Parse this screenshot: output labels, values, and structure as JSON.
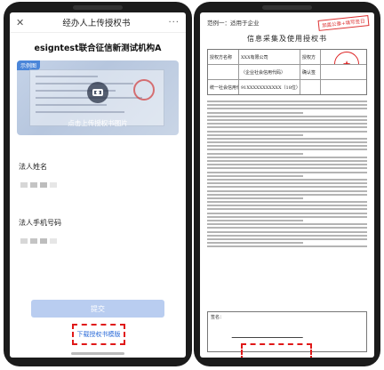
{
  "left_phone": {
    "nav": {
      "close_icon": "close-icon",
      "title": "经办人上传授权书",
      "more": "···"
    },
    "org_name": "esigntest联合征信新测试机构A",
    "upload": {
      "sample_tag": "示例图",
      "hint": "点击上传授权书图片"
    },
    "fields": [
      {
        "label": "法人姓名"
      },
      {
        "label": "法人手机号码"
      }
    ],
    "submit_label": "提交",
    "download_label": "下载授权书模版"
  },
  "right_phone": {
    "header": "范例一：适用于企业",
    "badge": "加盖公章+填写签日",
    "title": "信息采集及使用授权书",
    "table": {
      "rows": [
        {
          "k": "授权方名称",
          "v": "XXX有限公司",
          "k2": "授权方",
          "v2": ""
        },
        {
          "k": "",
          "v": "（企业社会信用代码）",
          "k2": "确认签",
          "v2": ""
        },
        {
          "k": "统一社会信用代码",
          "v": "91XXXXXXXXXXX（18位）",
          "k2": "",
          "v2": ""
        }
      ]
    },
    "footer": "签名：",
    "stamp_char": "★"
  },
  "colors": {
    "accent": "#2b6bd8",
    "highlight": "#e01818"
  }
}
